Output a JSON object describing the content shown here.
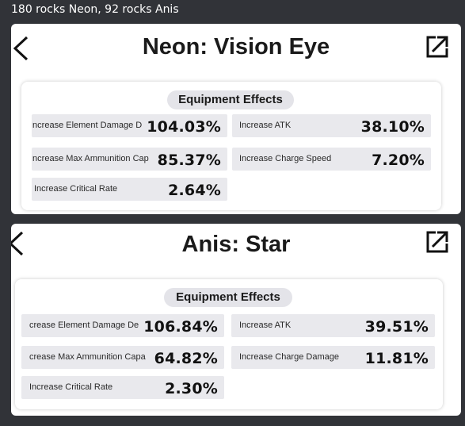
{
  "message": {
    "text": "180 rocks Neon, 92 rocks Anis"
  },
  "cards": [
    {
      "title": "Neon: Vision Eye",
      "section": "Equipment Effects",
      "effects": [
        {
          "label": "Increase Element Damage D",
          "value": "104.03%"
        },
        {
          "label": "Increase ATK",
          "value": "38.10%"
        },
        {
          "label": "Increase Max Ammunition Cap",
          "value": "85.37%"
        },
        {
          "label": "Increase Charge Speed",
          "value": "7.20%"
        },
        {
          "label": "Increase Critical Rate",
          "value": "2.64%"
        }
      ]
    },
    {
      "title": "Anis: Star",
      "section": "Equipment Effects",
      "effects": [
        {
          "label": "crease Element Damage De",
          "value": "106.84%"
        },
        {
          "label": "Increase ATK",
          "value": "39.51%"
        },
        {
          "label": "crease Max Ammunition Capa",
          "value": "64.82%"
        },
        {
          "label": "Increase Charge Damage",
          "value": "11.81%"
        },
        {
          "label": "Increase Critical Rate",
          "value": "2.30%"
        }
      ]
    }
  ],
  "icons": {
    "back": "chevron-left-icon",
    "expand": "open-external-icon"
  }
}
